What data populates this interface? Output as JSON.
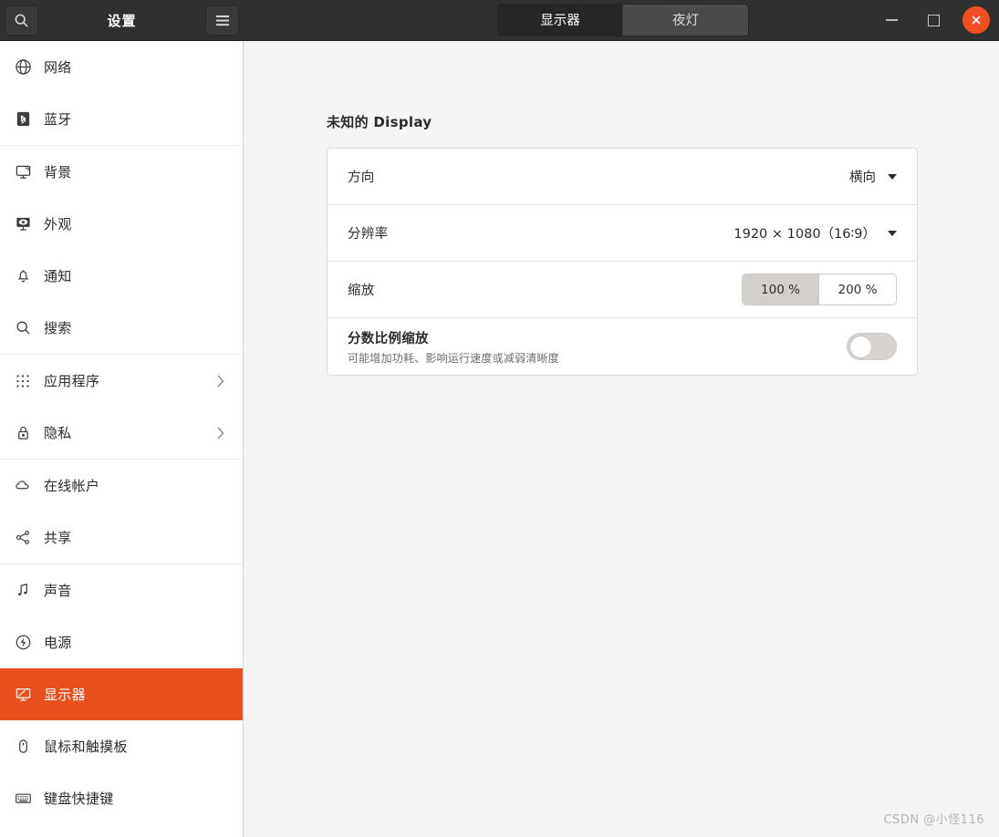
{
  "window": {
    "title": "设置",
    "search_icon": "search-icon",
    "menu_icon": "hamburger-menu-icon",
    "minimize_label": "−",
    "maximize_label": "□",
    "close_label": "×"
  },
  "tabs": [
    {
      "label": "显示器",
      "active": true
    },
    {
      "label": "夜灯",
      "active": false
    }
  ],
  "sidebar": {
    "groups": [
      {
        "items": [
          {
            "label": "网络",
            "icon": "globe-icon",
            "chevron": false,
            "selected": false
          },
          {
            "label": "蓝牙",
            "icon": "bluetooth-icon",
            "chevron": false,
            "selected": false
          }
        ]
      },
      {
        "items": [
          {
            "label": "背景",
            "icon": "wallpaper-monitor-icon",
            "chevron": false,
            "selected": false
          },
          {
            "label": "外观",
            "icon": "appearance-icon",
            "chevron": false,
            "selected": false
          },
          {
            "label": "通知",
            "icon": "bell-icon",
            "chevron": false,
            "selected": false
          },
          {
            "label": "搜索",
            "icon": "search-icon",
            "chevron": false,
            "selected": false
          }
        ]
      },
      {
        "items": [
          {
            "label": "应用程序",
            "icon": "apps-grid-icon",
            "chevron": true,
            "selected": false
          },
          {
            "label": "隐私",
            "icon": "lock-icon",
            "chevron": true,
            "selected": false
          }
        ]
      },
      {
        "items": [
          {
            "label": "在线帐户",
            "icon": "cloud-icon",
            "chevron": false,
            "selected": false
          },
          {
            "label": "共享",
            "icon": "share-icon",
            "chevron": false,
            "selected": false
          }
        ]
      },
      {
        "items": [
          {
            "label": "声音",
            "icon": "music-note-icon",
            "chevron": false,
            "selected": false
          },
          {
            "label": "电源",
            "icon": "power-icon",
            "chevron": false,
            "selected": false
          },
          {
            "label": "显示器",
            "icon": "display-monitor-icon",
            "chevron": false,
            "selected": true
          },
          {
            "label": "鼠标和触摸板",
            "icon": "mouse-icon",
            "chevron": false,
            "selected": false
          },
          {
            "label": "键盘快捷键",
            "icon": "keyboard-icon",
            "chevron": false,
            "selected": false
          }
        ]
      }
    ]
  },
  "main": {
    "panel_title": "未知的 Display",
    "orientation": {
      "label": "方向",
      "value": "横向"
    },
    "resolution": {
      "label": "分辨率",
      "value": "1920 × 1080（16∶9）"
    },
    "scale": {
      "label": "缩放",
      "options": [
        {
          "label": "100 %",
          "active": true
        },
        {
          "label": "200 %",
          "active": false
        }
      ]
    },
    "fractional_scaling": {
      "label": "分数比例缩放",
      "subtitle": "可能增加功耗、影响运行速度或减弱清晰度",
      "enabled": false
    }
  },
  "watermark": "CSDN @小怪116",
  "colors": {
    "headerbar": "#303030",
    "accent_orange": "#e8501e",
    "close_button": "#ef4f23",
    "content_bg": "#f6f5f4",
    "card_bg": "#ffffff"
  }
}
